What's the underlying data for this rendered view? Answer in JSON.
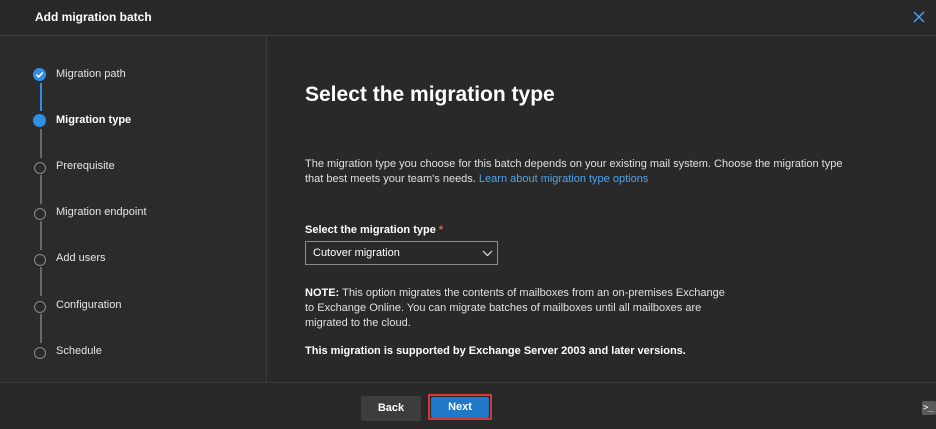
{
  "header": {
    "title": "Add migration batch",
    "close_icon": "close-icon"
  },
  "steps": [
    {
      "label": "Migration path",
      "state": "done"
    },
    {
      "label": "Migration type",
      "state": "active"
    },
    {
      "label": "Prerequisite",
      "state": "pending"
    },
    {
      "label": "Migration endpoint",
      "state": "pending"
    },
    {
      "label": "Add users",
      "state": "pending"
    },
    {
      "label": "Configuration",
      "state": "pending"
    },
    {
      "label": "Schedule",
      "state": "pending"
    }
  ],
  "main": {
    "title": "Select the migration type",
    "description": "The migration type you choose for this batch depends on your existing mail system. Choose the migration type that best meets your team's needs.",
    "learn_link": "Learn about migration type options",
    "field_label": "Select the migration type",
    "required_mark": "*",
    "selected_value": "Cutover migration",
    "note_label": "NOTE:",
    "note_text": "This option migrates the contents of mailboxes from an on-premises Exchange to Exchange Online. You can migrate batches of mailboxes until all mailboxes are migrated to the cloud.",
    "support_text": "This migration is supported by Exchange Server 2003 and later versions."
  },
  "footer": {
    "back_label": "Back",
    "next_label": "Next"
  },
  "corner": {
    "glyph": ">_"
  },
  "colors": {
    "background": "#292929",
    "accent": "#2f8fe5",
    "link": "#4aa4f4",
    "primary_button": "#1f78c8",
    "highlight_outline": "#d43a3a"
  }
}
